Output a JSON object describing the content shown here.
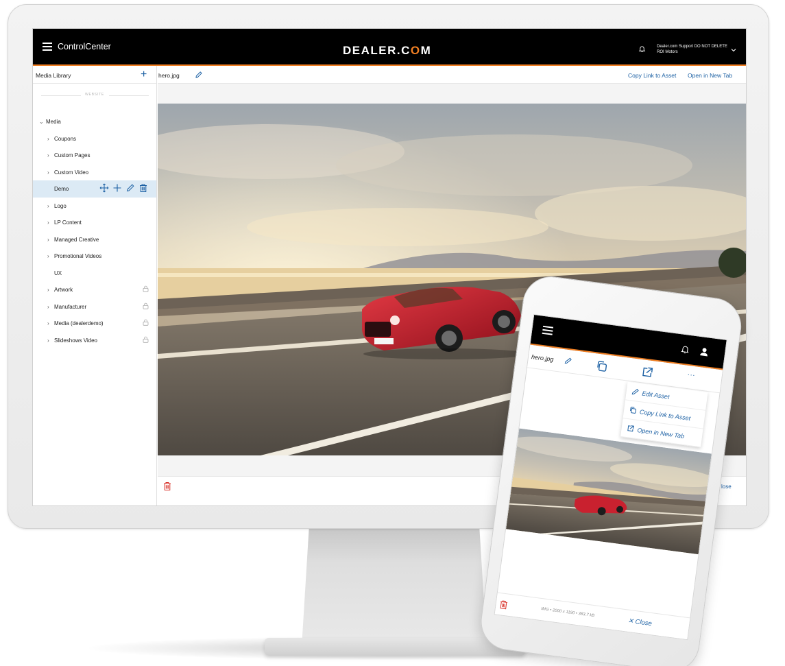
{
  "header": {
    "app_title": "ControlCenter",
    "brand_prefix": "DEALER.C",
    "brand_o": "O",
    "brand_suffix": "M",
    "user_line1": "Dealer.com Support DO NOT DELETE",
    "user_line2": "ROI Motors",
    "accent_color": "#f07f23"
  },
  "sidebar": {
    "title": "Media Library",
    "add_label": "+",
    "section_label": "WEBSITE",
    "items": [
      {
        "label": "Media",
        "chevron": "⌄",
        "level": 0
      },
      {
        "label": "Coupons",
        "chevron": "›",
        "level": 1
      },
      {
        "label": "Custom Pages",
        "chevron": "›",
        "level": 1
      },
      {
        "label": "Custom Video",
        "chevron": "›",
        "level": 1
      },
      {
        "label": "Demo",
        "chevron": "",
        "level": 1,
        "selected": true
      },
      {
        "label": "Logo",
        "chevron": "›",
        "level": 1
      },
      {
        "label": "LP Content",
        "chevron": "›",
        "level": 1
      },
      {
        "label": "Managed Creative",
        "chevron": "›",
        "level": 1
      },
      {
        "label": "Promotional Videos",
        "chevron": "›",
        "level": 1
      },
      {
        "label": "UX",
        "chevron": "",
        "level": 1
      },
      {
        "label": "Artwork",
        "chevron": "›",
        "level": 1,
        "locked": true
      },
      {
        "label": "Manufacturer",
        "chevron": "›",
        "level": 1,
        "locked": true
      },
      {
        "label": "Media (dealerdemo)",
        "chevron": "›",
        "level": 1,
        "locked": true
      },
      {
        "label": "Slideshows Video",
        "chevron": "›",
        "level": 1,
        "locked": true
      }
    ]
  },
  "main": {
    "file_name": "hero.jpg",
    "copy_link_label": "Copy Link to Asset",
    "open_tab_label": "Open in New Tab",
    "close_peek": "lose",
    "link_color": "#1a5fa3"
  },
  "phone": {
    "file_name": "hero.jpg",
    "more_label": "···",
    "menu": [
      {
        "label": "Edit Asset",
        "icon": "pencil-icon"
      },
      {
        "label": "Copy Link to Asset",
        "icon": "copy-icon"
      },
      {
        "label": "Open in New Tab",
        "icon": "external-link-icon"
      }
    ],
    "meta": "IMG  •  2000 x 1190  •  383.7 kB",
    "close_label": "✕ Close"
  }
}
